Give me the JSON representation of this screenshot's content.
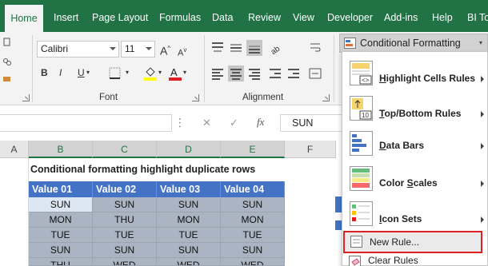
{
  "tabs": [
    "Home",
    "Insert",
    "Page Layout",
    "Formulas",
    "Data",
    "Review",
    "View",
    "Developer",
    "Add-ins",
    "Help",
    "BI To"
  ],
  "font": {
    "name": "Calibri",
    "size": "11",
    "bold": "B",
    "italic": "I",
    "underline": "U",
    "group_label": "Font"
  },
  "alignment": {
    "group_label": "Alignment"
  },
  "conditional_formatting": {
    "label": "Conditional Formatting"
  },
  "formula_bar": {
    "cancel": "✕",
    "enter": "✓",
    "fx": "fx",
    "value": "SUN"
  },
  "columns": [
    "A",
    "B",
    "C",
    "D",
    "E",
    "F"
  ],
  "sheet": {
    "title": "Conditional formatting highlight duplicate rows",
    "headers": [
      "Value 01",
      "Value 02",
      "Value 03",
      "Value 04"
    ],
    "rows": [
      [
        "SUN",
        "SUN",
        "SUN",
        "SUN"
      ],
      [
        "MON",
        "THU",
        "MON",
        "MON"
      ],
      [
        "TUE",
        "TUE",
        "TUE",
        "TUE"
      ],
      [
        "SUN",
        "SUN",
        "SUN",
        "SUN"
      ],
      [
        "THU",
        "WED",
        "WED",
        "WED"
      ]
    ]
  },
  "menu": {
    "items": [
      {
        "label": "Highlight Cells Rules",
        "key": "H"
      },
      {
        "label": "Top/Bottom Rules",
        "key": "T"
      },
      {
        "label": "Data Bars",
        "key": "D"
      },
      {
        "label": "Color Scales",
        "key": "S"
      },
      {
        "label": "Icon Sets",
        "key": "I"
      }
    ],
    "new_rule": "New Rule...",
    "clear_rules": "Clear Rules"
  },
  "colors": {
    "ribbon_green": "#217346",
    "header_blue": "#4472c4",
    "duplicate_fill": "#aab4c2",
    "highlight_red": "#e02020"
  }
}
